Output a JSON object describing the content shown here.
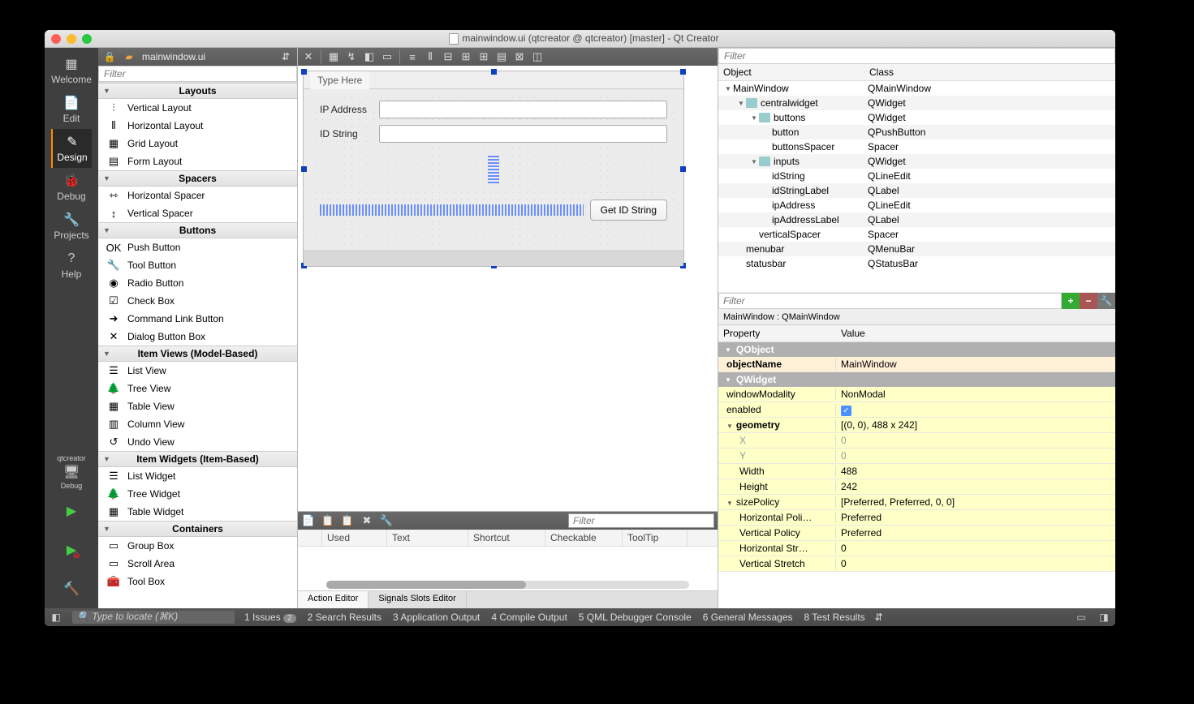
{
  "titlebar": "mainwindow.ui (qtcreator @ qtcreator) [master] - Qt Creator",
  "file_label": "mainwindow.ui",
  "nav": [
    {
      "label": "Welcome",
      "icon": "▦"
    },
    {
      "label": "Edit",
      "icon": "📄"
    },
    {
      "label": "Design",
      "icon": "✎",
      "active": true
    },
    {
      "label": "Debug",
      "icon": "🐞"
    },
    {
      "label": "Projects",
      "icon": "🔧"
    },
    {
      "label": "Help",
      "icon": "?"
    }
  ],
  "nav_bottom": {
    "project": "qtcreator",
    "kit": "🖥",
    "mode": "Debug"
  },
  "widgetbox": {
    "filter_placeholder": "Filter",
    "cats": [
      {
        "name": "Layouts",
        "items": [
          {
            "n": "Vertical Layout",
            "i": "⫶"
          },
          {
            "n": "Horizontal Layout",
            "i": "⫴"
          },
          {
            "n": "Grid Layout",
            "i": "▦"
          },
          {
            "n": "Form Layout",
            "i": "▤"
          }
        ]
      },
      {
        "name": "Spacers",
        "items": [
          {
            "n": "Horizontal Spacer",
            "i": "⇿"
          },
          {
            "n": "Vertical Spacer",
            "i": "↕"
          }
        ]
      },
      {
        "name": "Buttons",
        "items": [
          {
            "n": "Push Button",
            "i": "OK"
          },
          {
            "n": "Tool Button",
            "i": "🔧"
          },
          {
            "n": "Radio Button",
            "i": "◉"
          },
          {
            "n": "Check Box",
            "i": "☑"
          },
          {
            "n": "Command Link Button",
            "i": "➜"
          },
          {
            "n": "Dialog Button Box",
            "i": "✕"
          }
        ]
      },
      {
        "name": "Item Views (Model-Based)",
        "items": [
          {
            "n": "List View",
            "i": "☰"
          },
          {
            "n": "Tree View",
            "i": "🌲"
          },
          {
            "n": "Table View",
            "i": "▦"
          },
          {
            "n": "Column View",
            "i": "▥"
          },
          {
            "n": "Undo View",
            "i": "↺"
          }
        ]
      },
      {
        "name": "Item Widgets (Item-Based)",
        "items": [
          {
            "n": "List Widget",
            "i": "☰"
          },
          {
            "n": "Tree Widget",
            "i": "🌲"
          },
          {
            "n": "Table Widget",
            "i": "▦"
          }
        ]
      },
      {
        "name": "Containers",
        "items": [
          {
            "n": "Group Box",
            "i": "▭"
          },
          {
            "n": "Scroll Area",
            "i": "▭"
          },
          {
            "n": "Tool Box",
            "i": "🧰"
          }
        ]
      }
    ]
  },
  "form": {
    "type_here": "Type Here",
    "ip_label": "IP Address",
    "id_label": "ID String",
    "button": "Get ID String"
  },
  "action_editor": {
    "filter": "Filter",
    "cols": [
      "",
      "Used",
      "Text",
      "Shortcut",
      "Checkable",
      "ToolTip"
    ],
    "tabs": [
      "Action Editor",
      "Signals  Slots Editor"
    ]
  },
  "objects": {
    "filter": "Filter",
    "cols": [
      "Object",
      "Class"
    ],
    "rows": [
      {
        "o": "MainWindow",
        "c": "QMainWindow",
        "d": 0,
        "exp": true
      },
      {
        "o": "centralwidget",
        "c": "QWidget",
        "d": 1,
        "exp": true,
        "ico": true
      },
      {
        "o": "buttons",
        "c": "QWidget",
        "d": 2,
        "exp": true,
        "ico": true
      },
      {
        "o": "button",
        "c": "QPushButton",
        "d": 3
      },
      {
        "o": "buttonsSpacer",
        "c": "Spacer",
        "d": 3
      },
      {
        "o": "inputs",
        "c": "QWidget",
        "d": 2,
        "exp": true,
        "ico": true
      },
      {
        "o": "idString",
        "c": "QLineEdit",
        "d": 3
      },
      {
        "o": "idStringLabel",
        "c": "QLabel",
        "d": 3
      },
      {
        "o": "ipAddress",
        "c": "QLineEdit",
        "d": 3
      },
      {
        "o": "ipAddressLabel",
        "c": "QLabel",
        "d": 3
      },
      {
        "o": "verticalSpacer",
        "c": "Spacer",
        "d": 2
      },
      {
        "o": "menubar",
        "c": "QMenuBar",
        "d": 1
      },
      {
        "o": "statusbar",
        "c": "QStatusBar",
        "d": 1
      }
    ]
  },
  "properties": {
    "filter": "Filter",
    "path": "MainWindow : QMainWindow",
    "cols": [
      "Property",
      "Value"
    ],
    "rows": [
      {
        "t": "group",
        "n": "QObject"
      },
      {
        "n": "objectName",
        "v": "MainWindow",
        "b": true,
        "cls": "yo"
      },
      {
        "t": "group",
        "n": "QWidget"
      },
      {
        "n": "windowModality",
        "v": "NonModal",
        "cls": "yq"
      },
      {
        "n": "enabled",
        "v": "__check__",
        "cls": "yq"
      },
      {
        "n": "geometry",
        "v": "[(0, 0), 488 x 242]",
        "exp": true,
        "b": true,
        "cls": "yq"
      },
      {
        "n": "X",
        "v": "0",
        "cls": "yq",
        "sub": true
      },
      {
        "n": "Y",
        "v": "0",
        "cls": "yq",
        "sub": true
      },
      {
        "n": "Width",
        "v": "488",
        "cls": "yq",
        "sub": true,
        "subn": false
      },
      {
        "n": "Height",
        "v": "242",
        "cls": "yq",
        "sub": true,
        "subn": false
      },
      {
        "n": "sizePolicy",
        "v": "[Preferred, Preferred, 0, 0]",
        "exp": true,
        "cls": "yq"
      },
      {
        "n": "Horizontal Poli…",
        "v": "Preferred",
        "cls": "yq",
        "sub": true,
        "subn": false
      },
      {
        "n": "Vertical Policy",
        "v": "Preferred",
        "cls": "yq",
        "sub": true,
        "subn": false
      },
      {
        "n": "Horizontal Str…",
        "v": "0",
        "cls": "yq",
        "sub": true,
        "subn": false
      },
      {
        "n": "Vertical Stretch",
        "v": "0",
        "cls": "yq",
        "sub": true,
        "subn": false
      }
    ]
  },
  "statusbar": {
    "locate": "Type to locate (⌘K)",
    "tabs": [
      {
        "n": "1",
        "l": "Issues",
        "b": "2"
      },
      {
        "n": "2",
        "l": "Search Results"
      },
      {
        "n": "3",
        "l": "Application Output"
      },
      {
        "n": "4",
        "l": "Compile Output"
      },
      {
        "n": "5",
        "l": "QML Debugger Console"
      },
      {
        "n": "6",
        "l": "General Messages"
      },
      {
        "n": "8",
        "l": "Test Results"
      }
    ]
  }
}
